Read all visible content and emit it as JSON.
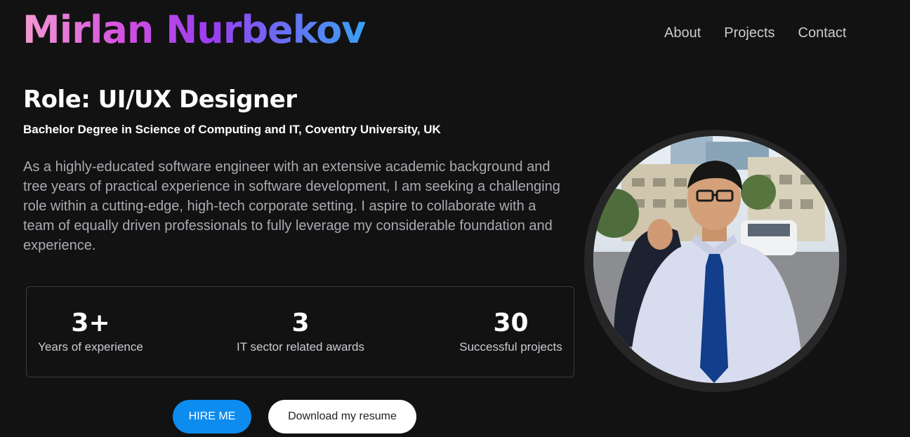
{
  "header": {
    "logo": "Mirlan Nurbekov",
    "nav": [
      {
        "label": "About"
      },
      {
        "label": "Projects"
      },
      {
        "label": "Contact"
      }
    ]
  },
  "hero": {
    "role": "Role: UI/UX Designer",
    "degree": "Bachelor Degree in Science of Computing and IT, Coventry University, UK",
    "bio": "As a highly-educated software engineer with an extensive academic background and tree years of practical experience in software development, I am seeking a challenging role within a cutting-edge, high-tech corporate setting. I aspire to collaborate with a team of equally driven professionals to fully leverage my considerable foundation and experience."
  },
  "stats": [
    {
      "value": "3+",
      "label": "Years of experience"
    },
    {
      "value": "3",
      "label": "IT sector related awards"
    },
    {
      "value": "30",
      "label": "Successful projects"
    }
  ],
  "buttons": {
    "hire": "HIRE ME",
    "resume": "Download my resume"
  },
  "colors": {
    "background": "#121212",
    "accent_blue": "#0d8cf0",
    "logo_gradient": [
      "#f39ad2",
      "#9b3df0",
      "#3aa0f3"
    ]
  }
}
